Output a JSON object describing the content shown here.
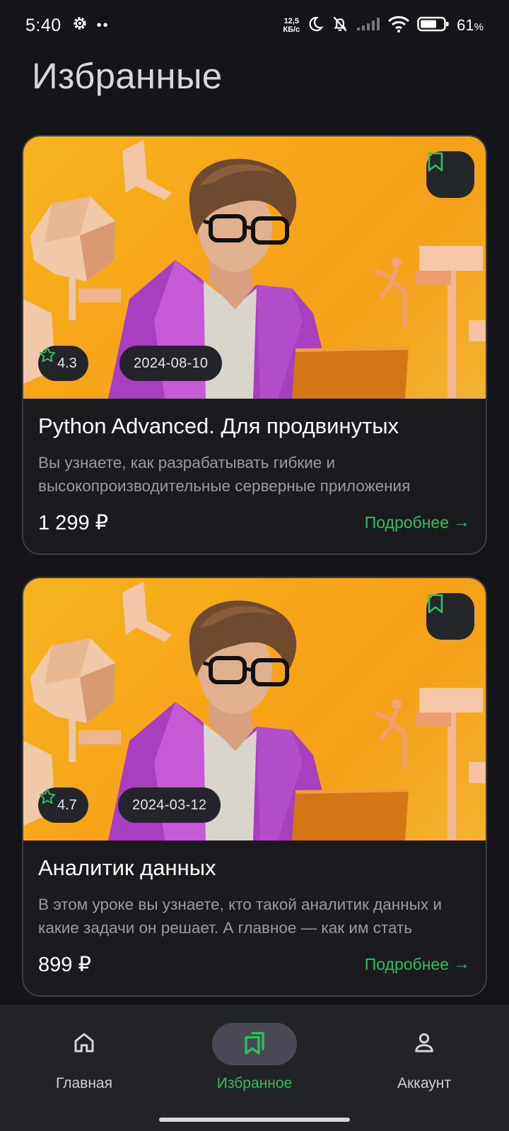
{
  "status_bar": {
    "time": "5:40",
    "dots": "••",
    "net_speed_value": "12,5",
    "net_speed_unit": "КБ/с",
    "battery_percent": "61",
    "battery_unit": "%"
  },
  "page": {
    "title": "Избранные"
  },
  "colors": {
    "accent": "#2fbf5f",
    "background": "#151419",
    "card": "#1b1b1f",
    "image_bg": "#f6a91b"
  },
  "courses": [
    {
      "rating": "4.3",
      "date": "2024-08-10",
      "title": "Python Advanced. Для продвинутых",
      "description": "Вы узнаете, как разрабатывать гибкие и высокопроизводительные серверные приложения",
      "price": "1 299 ₽",
      "more_label": "Подробнее",
      "more_arrow": "→"
    },
    {
      "rating": "4.7",
      "date": "2024-03-12",
      "title": "Аналитик данных",
      "description": "В этом уроке вы узнаете, кто такой аналитик данных и какие задачи он решает. А главное — как им стать",
      "price": "899 ₽",
      "more_label": "Подробнее",
      "more_arrow": "→"
    }
  ],
  "bottom_nav": {
    "items": [
      {
        "label": "Главная",
        "icon": "home-icon"
      },
      {
        "label": "Избранное",
        "icon": "bookmarks-icon",
        "active": true
      },
      {
        "label": "Аккаунт",
        "icon": "person-icon"
      }
    ]
  }
}
